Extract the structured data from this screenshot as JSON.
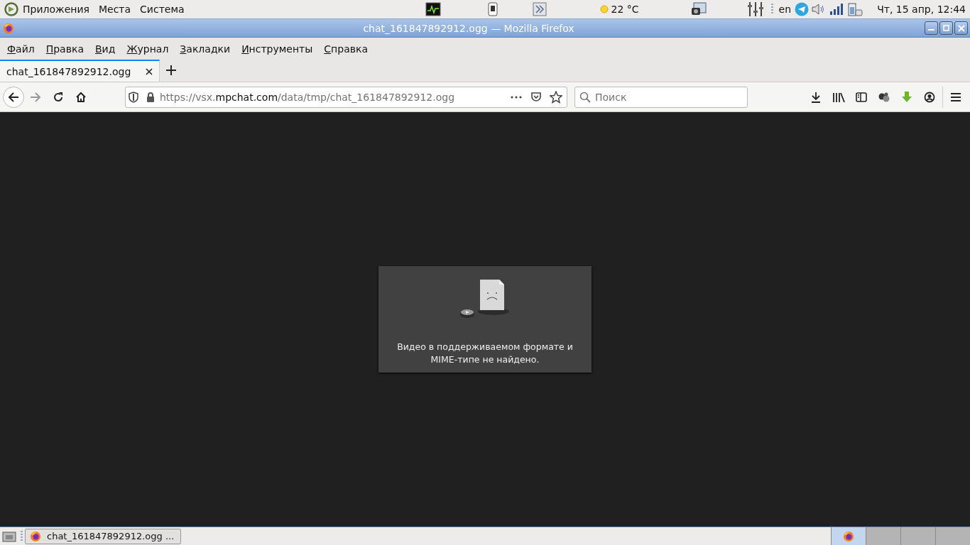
{
  "top_panel": {
    "menus": [
      "Приложения",
      "Места",
      "Система"
    ],
    "weather": "22 °C",
    "keyboard_layout": "en",
    "clock": "Чт, 15 апр, 12:44"
  },
  "window": {
    "title": "chat_161847892912.ogg — Mozilla Firefox"
  },
  "menubar": [
    "Файл",
    "Правка",
    "Вид",
    "Журнал",
    "Закладки",
    "Инструменты",
    "Справка"
  ],
  "tabs": [
    {
      "label": "chat_161847892912.ogg",
      "selected": true
    }
  ],
  "address_bar": {
    "url": "https://vsx.**mpchat.com**/data/tmp/chat_161847892912.ogg"
  },
  "search": {
    "placeholder": "Поиск"
  },
  "video_error": {
    "message": "Видео в поддерживаемом формате и MIME-типе не найдено."
  },
  "taskbar": {
    "windows": [
      {
        "label": "chat_161847892912.ogg ...",
        "selected": false
      }
    ],
    "workspaces": [
      {
        "selected": true
      },
      {
        "selected": false
      },
      {
        "selected": false
      },
      {
        "selected": false
      }
    ]
  }
}
